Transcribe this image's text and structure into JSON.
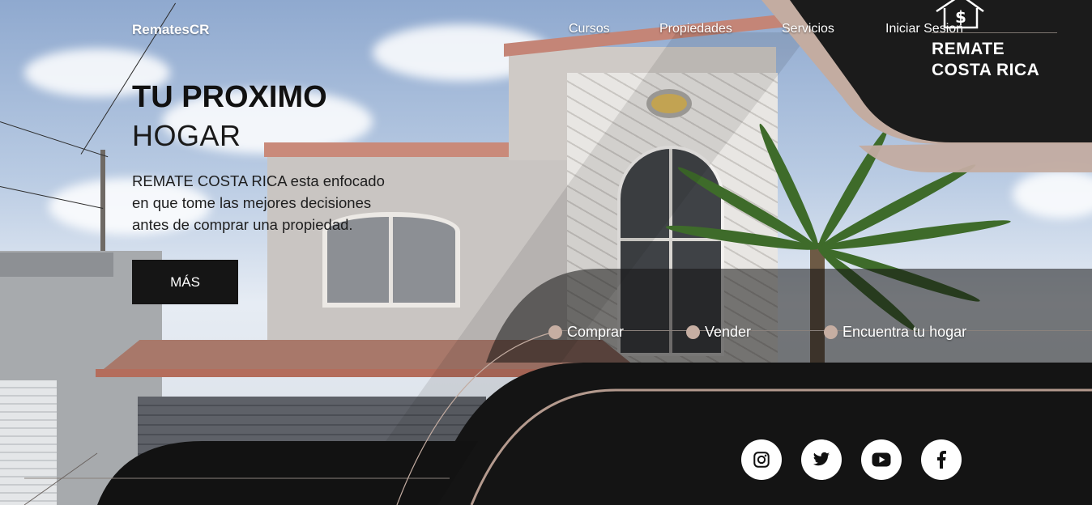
{
  "nav": {
    "brand": "RematesCR",
    "links": [
      "Cursos",
      "Propiedades",
      "Servicios",
      "Iniciar Sesion"
    ]
  },
  "logo": {
    "line1": "REMATE",
    "line2": "COSTA RICA"
  },
  "hero": {
    "title": "TU PROXIMO",
    "subtitle": "HOGAR",
    "description": "REMATE COSTA RICA esta enfocado en que tome las mejores decisiones antes de comprar una propiedad.",
    "button_label": "MÁS"
  },
  "features": [
    "Comprar",
    "Vender",
    "Encuentra tu hogar"
  ],
  "social": [
    "instagram-icon",
    "twitter-icon",
    "youtube-icon",
    "facebook-icon"
  ],
  "colors": {
    "dark": "#151515",
    "accent": "#c6aea2",
    "text": "#ffffff"
  }
}
